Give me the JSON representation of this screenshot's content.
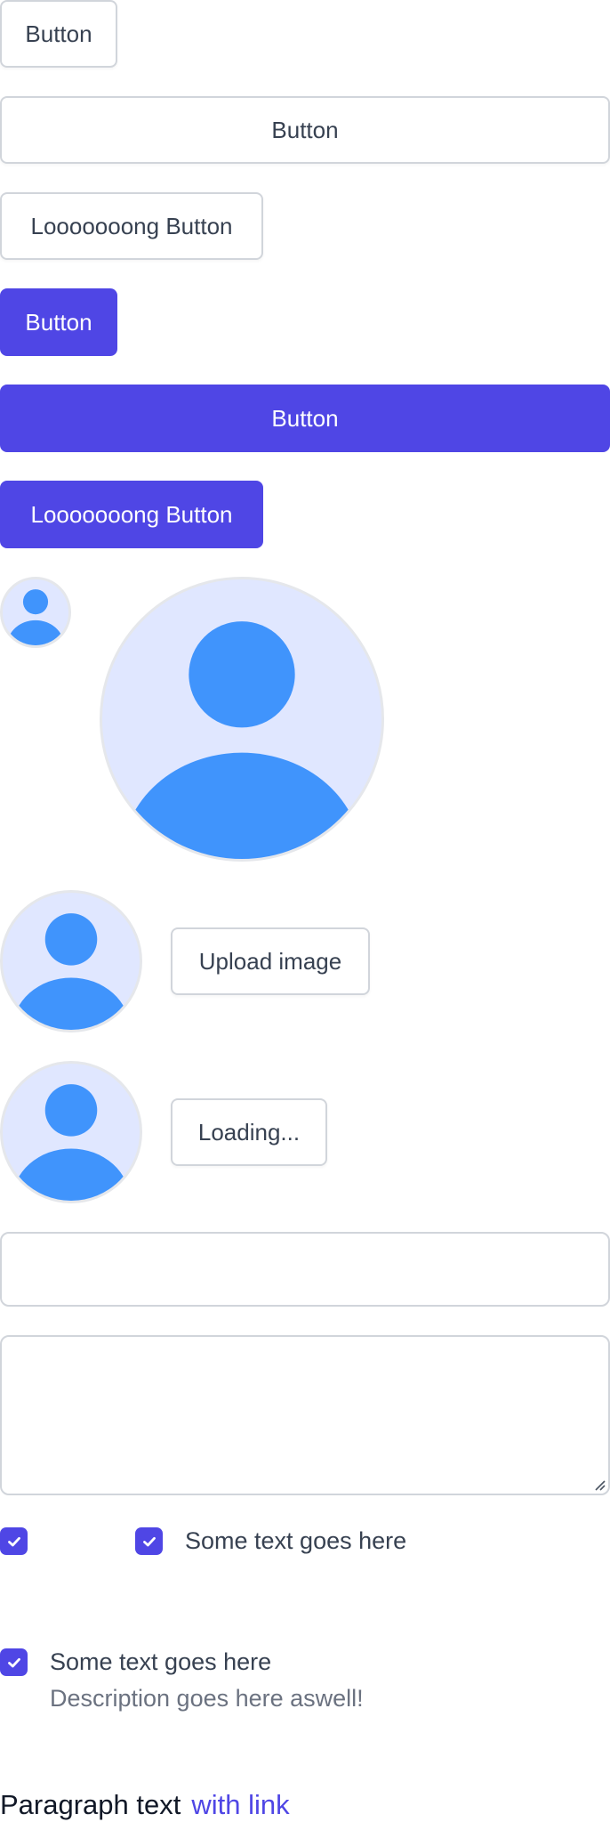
{
  "buttons": {
    "secondary_small": "Button",
    "secondary_full": "Button",
    "secondary_long": "Looooooong Button",
    "primary_small": "Button",
    "primary_full": "Button",
    "primary_long": "Looooooong Button"
  },
  "avatars": {
    "icon": "user-avatar-icon",
    "colors": {
      "background": "#e0e7ff",
      "figure": "#4094fc",
      "border": "#e5e7eb"
    }
  },
  "upload": {
    "upload_label": "Upload image",
    "loading_label": "Loading..."
  },
  "fields": {
    "text_input_value": "",
    "textarea_value": ""
  },
  "checkboxes": {
    "checked_icon": "check-icon",
    "inline_label": "Some text goes here",
    "stacked_label": "Some text goes here",
    "stacked_description": "Description goes here aswell!"
  },
  "paragraph": {
    "text": "Paragraph text",
    "link": "with link"
  },
  "colors": {
    "primary": "#4f46e5",
    "border": "#d1d5db",
    "text": "#374151",
    "muted": "#6b7280"
  }
}
